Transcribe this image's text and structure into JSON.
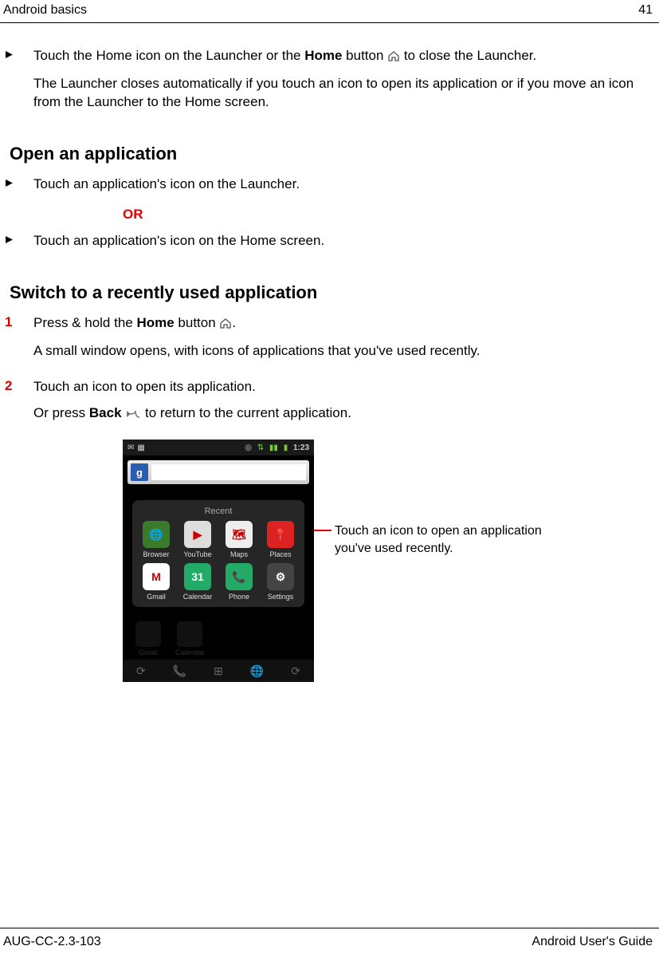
{
  "header": {
    "left": "Android basics",
    "right": "41"
  },
  "footer": {
    "left": "AUG-CC-2.3-103",
    "right": "Android User's Guide"
  },
  "s0": {
    "i1a": "Touch the Home icon on the Launcher or the ",
    "i1b": "Home",
    "i1c": " button ",
    "i1d": " to close the Launcher.",
    "i1e": "The Launcher closes automatically if you touch an icon to open its application or if you move an icon from the Launcher to the Home screen."
  },
  "s1": {
    "title": "Open an application",
    "i1": "Touch an application's icon on the Launcher.",
    "or": "OR",
    "i2": "Touch an application's icon on the Home screen."
  },
  "s2": {
    "title": "Switch to a recently used application",
    "n1a": "Press & hold the ",
    "n1b": "Home",
    "n1c": " button ",
    "n1d": ".",
    "n1e": "A small window opens, with icons of applications that you've used recently.",
    "n2a": "Touch an icon to open its application.",
    "n2b1": "Or press ",
    "n2b2": "Back",
    "n2b3": " ",
    "n2b4": " to return to the current application."
  },
  "callout": "Touch an icon to open an application you've used recently.",
  "phone": {
    "clock": "1:23",
    "recent_label": "Recent",
    "apps": [
      {
        "label": "Browser",
        "bg": "#3a7a2a",
        "txt": "🌐"
      },
      {
        "label": "YouTube",
        "bg": "#ddd",
        "txt": "▶"
      },
      {
        "label": "Maps",
        "bg": "#eee",
        "txt": "🗺"
      },
      {
        "label": "Places",
        "bg": "#d22",
        "txt": "📍"
      },
      {
        "label": "Gmail",
        "bg": "#fff",
        "txt": "M"
      },
      {
        "label": "Calendar",
        "bg": "#2a6",
        "txt": "31"
      },
      {
        "label": "Phone",
        "bg": "#2a6",
        "txt": "📞"
      },
      {
        "label": "Settings",
        "bg": "#444",
        "txt": "⚙"
      }
    ],
    "dim": [
      "Gmail",
      "Calendar"
    ],
    "g": "g"
  },
  "markers": {
    "n1": "1",
    "n2": "2"
  }
}
